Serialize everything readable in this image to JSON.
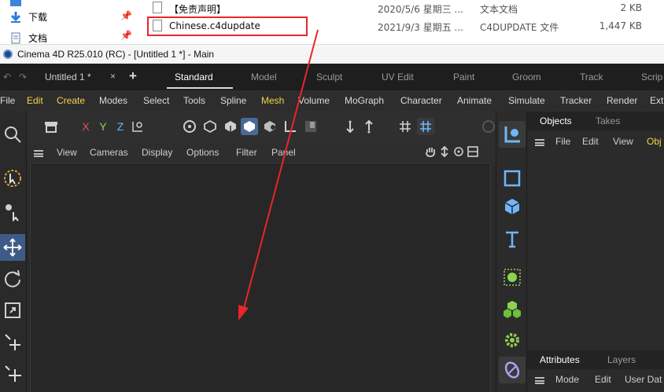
{
  "explorer": {
    "quick_access": [
      {
        "label": "下载",
        "icon": "download-arrow-icon"
      },
      {
        "label": "文档",
        "icon": "documents-icon"
      }
    ],
    "files": [
      {
        "name": "【免责声明】",
        "date": "2020/5/6 星期三 ...",
        "type": "文本文档",
        "size": "2 KB"
      },
      {
        "name": "Chinese.c4dupdate",
        "date": "2021/9/3 星期五 ...",
        "type": "C4DUPDATE 文件",
        "size": "1,447 KB"
      }
    ]
  },
  "window": {
    "title": "Cinema 4D R25.010 (RC) - [Untitled 1 *] - Main"
  },
  "tabbar": {
    "doc_tab": "Untitled 1 *",
    "close": "×",
    "add": "+",
    "layouts": [
      "Standard",
      "Model",
      "Sculpt",
      "UV Edit",
      "Paint",
      "Groom",
      "Track",
      "Scrip"
    ],
    "active_layout": "Standard"
  },
  "menubar": {
    "items": [
      "File",
      "Edit",
      "Create",
      "Modes",
      "Select",
      "Tools",
      "Spline",
      "Mesh",
      "Volume",
      "MoGraph",
      "Character",
      "Animate",
      "Simulate",
      "Tracker",
      "Render",
      "Ext"
    ]
  },
  "toptool": {
    "axis_x": "X",
    "axis_y": "Y",
    "axis_z": "Z"
  },
  "viewport": {
    "menu": [
      "View",
      "Cameras",
      "Display",
      "Options",
      "Filter",
      "Panel"
    ]
  },
  "objects_panel": {
    "tabs": [
      "Objects",
      "Takes"
    ],
    "menu": [
      "File",
      "Edit",
      "View",
      "Obj"
    ]
  },
  "attributes_panel": {
    "tabs": [
      "Attributes",
      "Layers"
    ],
    "menu": [
      "Mode",
      "Edit",
      "User Dat"
    ]
  },
  "colors": {
    "highlight_box": "#e8262a",
    "arrow": "#e8262a",
    "active_tool": "#3e5b87",
    "menu_highlight": "#f2d44a",
    "accent_green": "#8fd14f",
    "accent_blue": "#6fb6ff"
  }
}
